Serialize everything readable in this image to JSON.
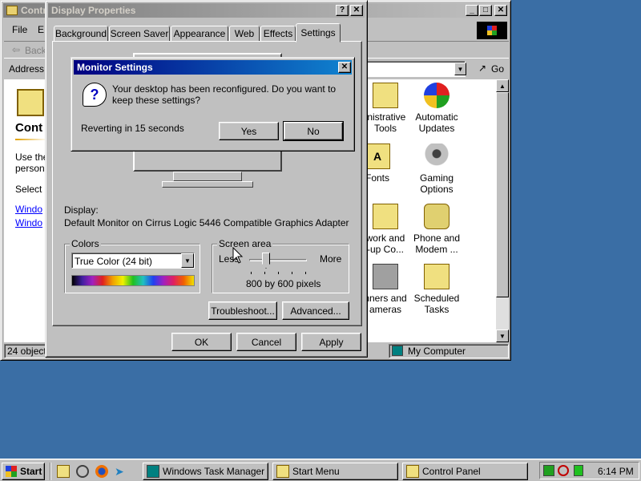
{
  "control_panel": {
    "title": "Contr",
    "menu": [
      "File",
      "E"
    ],
    "back_label": "Back",
    "address_label": "Address",
    "go_label": "Go",
    "heading": "Cont",
    "desc_line1": "Use the",
    "desc_line2": "persona",
    "select_text": "Select a",
    "link1": "Windo",
    "link2": "Windo",
    "status_left": "24 object(",
    "status_right": "My Computer",
    "icons": [
      {
        "label1": "inistrative",
        "label2": "Tools"
      },
      {
        "label1": "Automatic",
        "label2": "Updates"
      },
      {
        "label1": "Fonts",
        "label2": ""
      },
      {
        "label1": "Gaming",
        "label2": "Options"
      },
      {
        "label1": "work and",
        "label2": "-up Co..."
      },
      {
        "label1": "Phone and",
        "label2": "Modem ..."
      },
      {
        "label1": "nners and",
        "label2": "ameras"
      },
      {
        "label1": "Scheduled",
        "label2": "Tasks"
      }
    ]
  },
  "display_props": {
    "title": "Display Properties",
    "tabs": [
      "Background",
      "Screen Saver",
      "Appearance",
      "Web",
      "Effects",
      "Settings"
    ],
    "display_label": "Display:",
    "display_value": "Default Monitor on Cirrus Logic 5446 Compatible Graphics Adapter",
    "colors_label": "Colors",
    "colors_value": "True Color (24 bit)",
    "screen_area_label": "Screen area",
    "less_label": "Less",
    "more_label": "More",
    "resolution": "800 by 600 pixels",
    "troubleshoot_label": "Troubleshoot...",
    "advanced_label": "Advanced...",
    "ok_label": "OK",
    "cancel_label": "Cancel",
    "apply_label": "Apply"
  },
  "monitor_dialog": {
    "title": "Monitor Settings",
    "message": "Your desktop has been reconfigured.  Do you want to keep these settings?",
    "countdown": "Reverting in 15 seconds",
    "yes_label": "Yes",
    "no_label": "No"
  },
  "taskbar": {
    "start_label": "Start",
    "tasks": [
      "Windows Task Manager",
      "Start Menu",
      "Control Panel"
    ],
    "clock": "6:14 PM"
  },
  "colors": {
    "desktop": "#3a6ea5",
    "title_active": "#000080",
    "title_inactive": "#808080"
  }
}
